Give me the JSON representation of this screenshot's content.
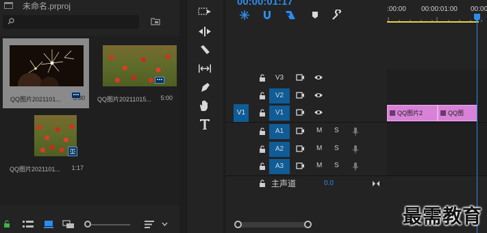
{
  "project": {
    "name": "未命名.prproj",
    "search": {
      "value": "",
      "placeholder": ""
    },
    "clips": [
      {
        "name": "QQ图片2021101...",
        "duration": "5:00",
        "thumbnail": "fireworks",
        "badge": "video-badge-icon",
        "selected": true
      },
      {
        "name": "QQ图片20211015...",
        "duration": "5:00",
        "thumbnail": "poppies",
        "badge": "video-badge-icon",
        "selected": false
      },
      {
        "name": "QQ图片2021101...",
        "duration": "1:17",
        "thumbnail": "poppies",
        "badge": "sequence-badge-icon",
        "selected": false
      }
    ],
    "footer_icons": [
      "lock-icon",
      "list-view-icon",
      "icon-view-icon",
      "freeform-view-icon",
      "zoom-slider",
      "sort-icon",
      "chevron-down-icon",
      "new-item-icon"
    ]
  },
  "tools": [
    "track-select-icon",
    "ripple-edit-icon",
    "razor-icon",
    "slip-icon",
    "pen-icon",
    "hand-icon",
    "type-icon"
  ],
  "timeline": {
    "timecode": "00:00:01:17",
    "toolbar_icons": [
      "nest-icon",
      "snap-icon",
      "linked-selection-icon",
      "add-marker-icon",
      "settings-icon"
    ],
    "ruler_labels": [
      ":00:00",
      "00:00:01:00",
      "00:00"
    ],
    "tracks": [
      {
        "id": "V3",
        "source": "",
        "targeted": false,
        "kind": "video"
      },
      {
        "id": "V2",
        "source": "",
        "targeted": true,
        "kind": "video"
      },
      {
        "id": "V1",
        "source": "V1",
        "targeted": true,
        "kind": "video"
      },
      {
        "id": "A1",
        "source": "",
        "targeted": true,
        "kind": "audio"
      },
      {
        "id": "A2",
        "source": "",
        "targeted": true,
        "kind": "audio"
      },
      {
        "id": "A3",
        "source": "",
        "targeted": true,
        "kind": "audio"
      }
    ],
    "audio_buttons": {
      "mute": "M",
      "solo": "S"
    },
    "clips_on_v1": [
      {
        "label": "QQ图片2"
      },
      {
        "label": "QQ图"
      }
    ],
    "master": {
      "label": "主声道",
      "value": "0.0"
    }
  },
  "watermark": "最需教育",
  "colors": {
    "accent": "#2d8ceb",
    "clip": "#d782d7",
    "target": "#0f5c97",
    "workarea": "#e3d34a"
  }
}
